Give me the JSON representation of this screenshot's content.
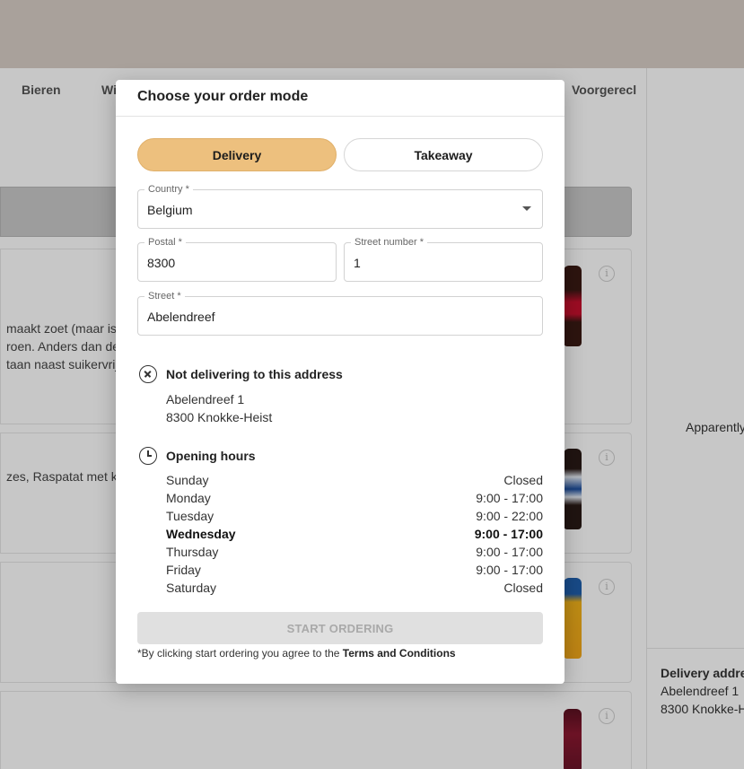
{
  "background": {
    "categories": [
      "Bieren",
      "Wi",
      "Voorgerecl"
    ],
    "card_texts": [
      [
        "maakt zoet (maar is",
        "roen. Anders dan de",
        "taan naast suikervrije"
      ],
      [
        "zes, Raspatat met ke"
      ]
    ],
    "info_symbol": "i",
    "side_text": "Apparently",
    "delivery_address_title": "Delivery addres",
    "delivery_address_line1": "Abelendreef 1",
    "delivery_address_line2": "8300 Knokke-H"
  },
  "modal": {
    "title": "Choose your order mode",
    "modes": {
      "delivery": "Delivery",
      "takeaway": "Takeaway"
    },
    "country": {
      "label": "Country *",
      "value": "Belgium"
    },
    "postal": {
      "label": "Postal *",
      "value": "8300"
    },
    "street_number": {
      "label": "Street number *",
      "value": "1"
    },
    "street": {
      "label": "Street *",
      "value": "Abelendreef"
    },
    "not_delivering": {
      "title": "Not delivering to this address",
      "line1": "Abelendreef 1",
      "line2": "8300 Knokke-Heist"
    },
    "opening_hours": {
      "title": "Opening hours",
      "days": [
        {
          "day": "Sunday",
          "hours": "Closed"
        },
        {
          "day": "Monday",
          "hours": "9:00 - 17:00"
        },
        {
          "day": "Tuesday",
          "hours": "9:00 - 22:00"
        },
        {
          "day": "Wednesday",
          "hours": "9:00 - 17:00"
        },
        {
          "day": "Thursday",
          "hours": "9:00 - 17:00"
        },
        {
          "day": "Friday",
          "hours": "9:00 - 17:00"
        },
        {
          "day": "Saturday",
          "hours": "Closed"
        }
      ]
    },
    "start_button": "START ORDERING",
    "terms_prefix": "*By clicking start ordering you agree to the",
    "terms_link": "Terms and Conditions"
  },
  "colors": {
    "accent": "#edc07e",
    "hero": "#d9cfc7"
  }
}
